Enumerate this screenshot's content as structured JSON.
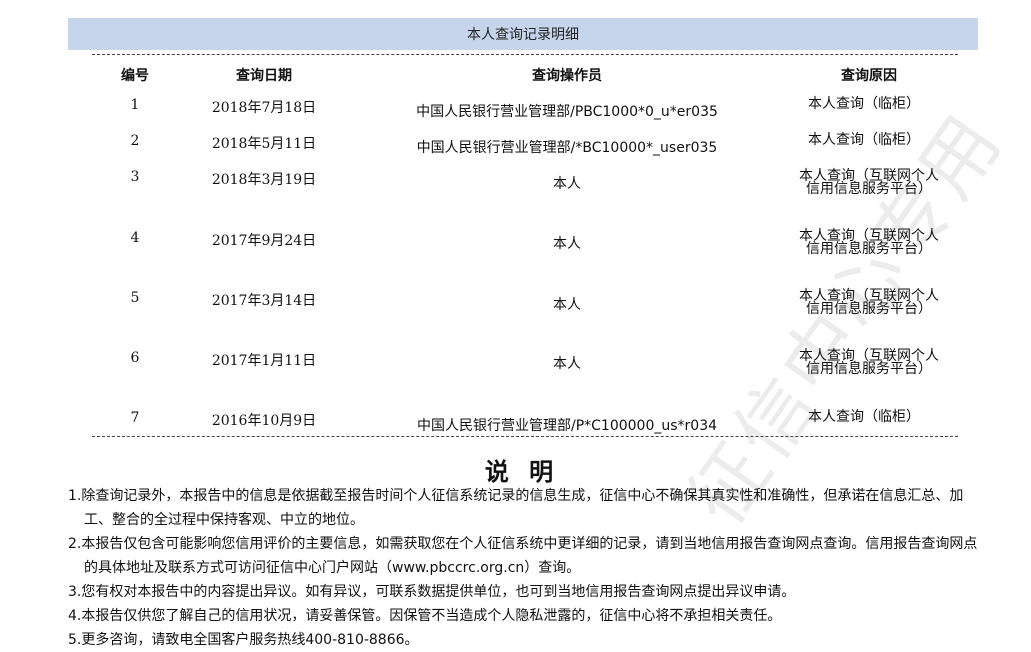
{
  "section_title": "本人查询记录明细",
  "columns": {
    "num": "编号",
    "date": "查询日期",
    "operator": "查询操作员",
    "reason": "查询原因"
  },
  "rows": [
    {
      "num": "1",
      "date": "2018年7月18日",
      "operator": "中国人民银行营业管理部/PBC1000*0_u*er035",
      "reason": "本人查询（临柜）"
    },
    {
      "num": "2",
      "date": "2018年5月11日",
      "operator": "中国人民银行营业管理部/*BC10000*_user035",
      "reason": "本人查询（临柜）"
    },
    {
      "num": "3",
      "date": "2018年3月19日",
      "operator": "本人",
      "reason": "本人查询（互联网个人信用信息服务平台）"
    },
    {
      "num": "4",
      "date": "2017年9月24日",
      "operator": "本人",
      "reason": "本人查询（互联网个人信用信息服务平台）"
    },
    {
      "num": "5",
      "date": "2017年3月14日",
      "operator": "本人",
      "reason": "本人查询（互联网个人信用信息服务平台）"
    },
    {
      "num": "6",
      "date": "2017年1月11日",
      "operator": "本人",
      "reason": "本人查询（互联网个人信用信息服务平台）"
    },
    {
      "num": "7",
      "date": "2016年10月9日",
      "operator": "中国人民银行营业管理部/P*C100000_us*r034",
      "reason": "本人查询（临柜）"
    }
  ],
  "notes_title": "说 明",
  "notes": [
    "1.除查询记录外，本报告中的信息是依据截至报告时间个人征信系统记录的信息生成，征信中心不确保其真实性和准确性，但承诺在信息汇总、加工、整合的全过程中保持客观、中立的地位。",
    "2.本报告仅包含可能影响您信用评价的主要信息，如需获取您在个人征信系统中更详细的记录，请到当地信用报告查询网点查询。信用报告查询网点的具体地址及联系方式可访问征信中心门户网站（www.pbccrc.org.cn）查询。",
    "3.您有权对本报告中的内容提出异议。如有异议，可联系数据提供单位，也可到当地信用报告查询网点提出异议申请。",
    "4.本报告仅供您了解自己的信用状况，请妥善保管。因保管不当造成个人隐私泄露的，征信中心将不承担相关责任。",
    "5.更多咨询，请致电全国客户服务热线400-810-8866。"
  ],
  "watermark": "征信中心"
}
